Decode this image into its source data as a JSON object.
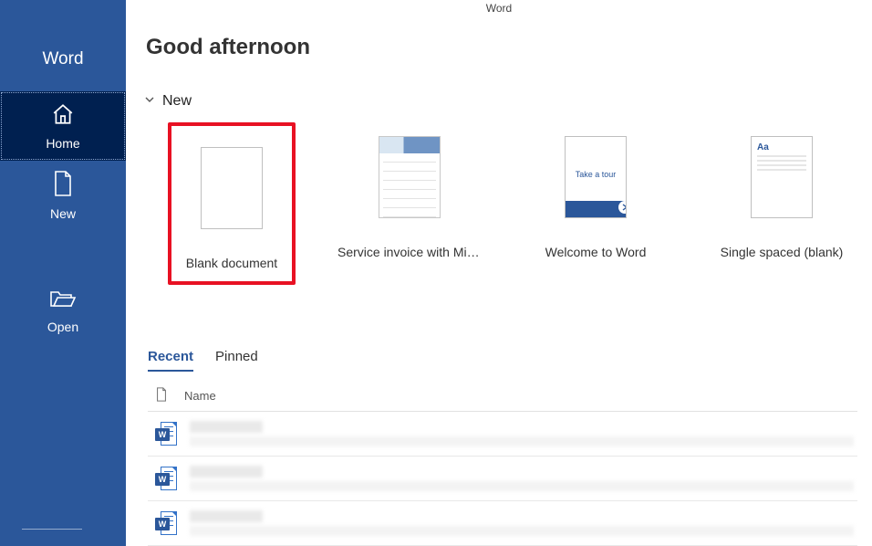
{
  "app_name": "Word",
  "title_bar": "Word",
  "sidebar": {
    "items": [
      {
        "label": "Home",
        "selected": true
      },
      {
        "label": "New",
        "selected": false
      },
      {
        "label": "Open",
        "selected": false
      }
    ]
  },
  "greeting": "Good afternoon",
  "new_section": {
    "heading": "New",
    "templates": [
      {
        "label": "Blank document",
        "highlighted": true
      },
      {
        "label": "Service invoice with Micros…"
      },
      {
        "label": "Welcome to Word",
        "tour_text": "Take a tour"
      },
      {
        "label": "Single spaced (blank)",
        "aa": "Aa"
      }
    ]
  },
  "tabs": [
    {
      "label": "Recent",
      "active": true
    },
    {
      "label": "Pinned",
      "active": false
    }
  ],
  "doc_list": {
    "columns": {
      "name": "Name"
    },
    "rows": 3,
    "doc_icon_letter": "W"
  }
}
